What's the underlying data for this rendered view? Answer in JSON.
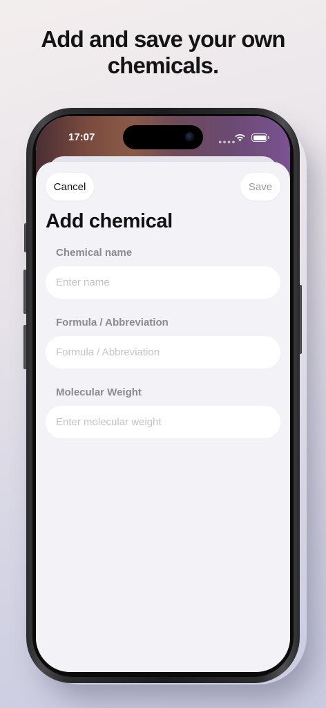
{
  "headline": {
    "line1": "Add and save your own",
    "line2": "chemicals."
  },
  "status_bar": {
    "time": "17:07",
    "signal_icon": "signal-dots-icon",
    "wifi_icon": "wifi-icon",
    "battery_icon": "battery-icon"
  },
  "sheet": {
    "cancel_label": "Cancel",
    "save_label": "Save",
    "title": "Add chemical",
    "fields": [
      {
        "label": "Chemical name",
        "placeholder": "Enter name",
        "value": ""
      },
      {
        "label": "Formula / Abbreviation",
        "placeholder": "Formula / Abbreviation",
        "value": ""
      },
      {
        "label": "Molecular Weight",
        "placeholder": "Enter molecular weight",
        "value": ""
      }
    ]
  },
  "colors": {
    "background": "#e6e2e8",
    "sheet_background": "#f2f2f7",
    "label_gray": "#8a8a8f",
    "disabled_save": "#9b9ba0",
    "text": "#111111"
  }
}
